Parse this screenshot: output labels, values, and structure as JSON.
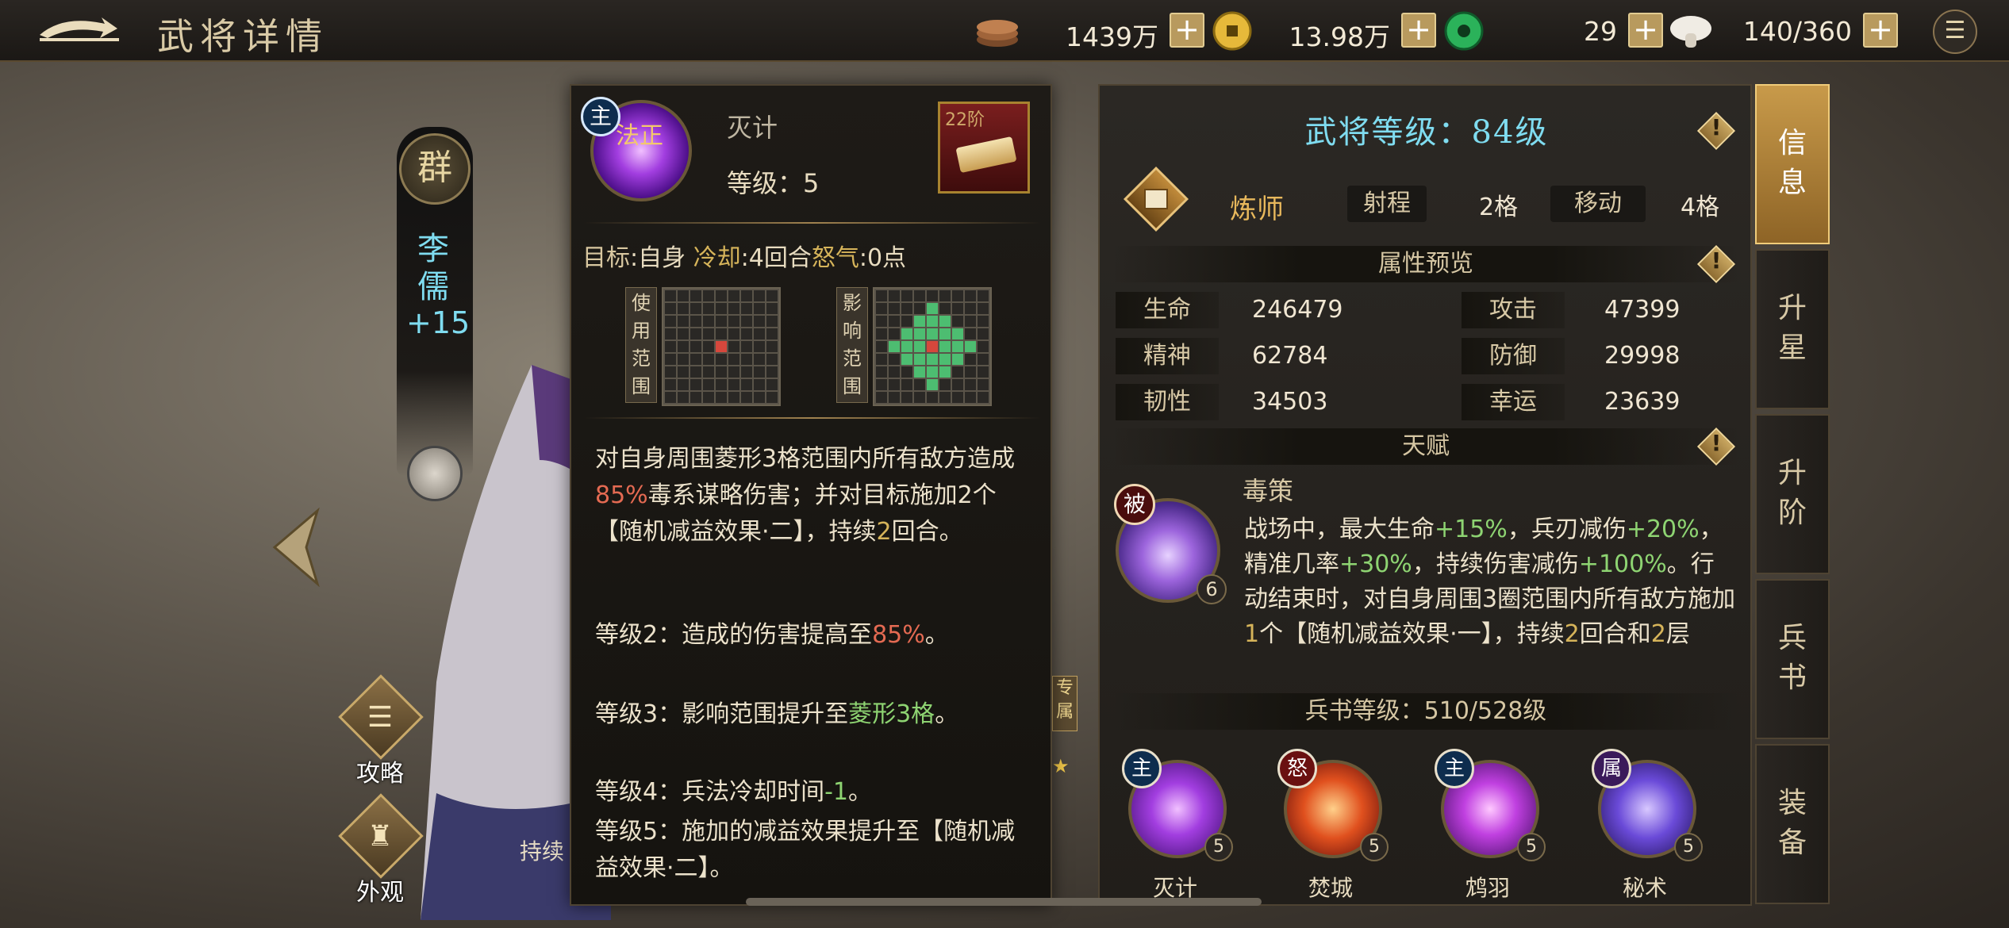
{
  "header": {
    "title": "武将详情"
  },
  "resources": [
    {
      "icon": "copper-coins-icon",
      "value": "1439万"
    },
    {
      "icon": "gold-coin-icon",
      "value": "13.98万"
    },
    {
      "icon": "jade-icon",
      "value": "29"
    },
    {
      "icon": "mushroom-icon",
      "value": "140/360"
    }
  ],
  "hero": {
    "faction": "群",
    "name": "李儒",
    "level": "+15"
  },
  "side_buttons": {
    "strategy": "攻略",
    "appearance": "外观"
  },
  "partial": {
    "left_text": "持续",
    "tag": "专属",
    "star": "★"
  },
  "skill": {
    "badge": "主",
    "type_tag": "法正",
    "name": "灭计",
    "level": "等级：5",
    "book_stage": "22阶",
    "meta": {
      "target_k": "目标",
      "target_v": "自身",
      "cd_k": "冷却",
      "cd_v": "4回合",
      "rage_k": "怒气",
      "rage_v": "0点"
    },
    "use_range_label": "使用范围",
    "effect_range_label": "影响范围",
    "desc_parts": {
      "p1a": "对自身周围菱形3格范围内所有敌方造成",
      "p1b": "85%",
      "p1c": "毒系谋略伤害；并对目标施加2个【随机减益效果·二】，持续",
      "p1d": "2",
      "p1e": "回合。",
      "l2a": "等级2：造成的伤害提高至",
      "l2b": "85%",
      "l2c": "。",
      "l3a": "等级3：影响范围提升至",
      "l3b": "菱形3格",
      "l3c": "。",
      "l4a": "等级4：兵法冷却时间",
      "l4b": "-1",
      "l4c": "。",
      "l5": "等级5：施加的减益效果提升至【随机减益效果·二】。"
    }
  },
  "info": {
    "title": "武将等级：84级",
    "warn": "!",
    "class_name": "炼师",
    "range_k": "射程",
    "range_v": "2格",
    "move_k": "移动",
    "move_v": "4格",
    "attr_title": "属性预览",
    "stats": [
      {
        "k": "生命",
        "v": "246479"
      },
      {
        "k": "攻击",
        "v": "47399"
      },
      {
        "k": "精神",
        "v": "62784"
      },
      {
        "k": "防御",
        "v": "29998"
      },
      {
        "k": "韧性",
        "v": "34503"
      },
      {
        "k": "幸运",
        "v": "23639"
      }
    ],
    "talent_title": "天赋",
    "talent": {
      "badge": "被",
      "level": "6",
      "name": "毒策",
      "d1": "战场中，最大生命",
      "d2": "+15%",
      "d3": "，兵刃减伤",
      "d4": "+20%",
      "d5": "，精准几率",
      "d6": "+30%",
      "d7": "，持续伤害减伤",
      "d8": "+100%",
      "d9": "。行动结束时，对自身周围3圈范围内所有敌方施加",
      "d10": "1",
      "d11": "个【随机减益效果·一】，持续",
      "d12": "2",
      "d13": "回合和",
      "d14": "2",
      "d15": "层"
    },
    "book_title": "兵书等级：510/528级",
    "book_skills": [
      {
        "badge": "主",
        "name": "灭计",
        "level": "5"
      },
      {
        "badge": "怒",
        "name": "焚城",
        "level": "5"
      },
      {
        "badge": "主",
        "name": "鸩羽",
        "level": "5"
      },
      {
        "badge": "属",
        "name": "秘术",
        "level": "5"
      }
    ]
  },
  "tabs": [
    {
      "label": "信息"
    },
    {
      "label": "升星"
    },
    {
      "label": "升阶"
    },
    {
      "label": "兵书"
    },
    {
      "label": "装备"
    }
  ]
}
